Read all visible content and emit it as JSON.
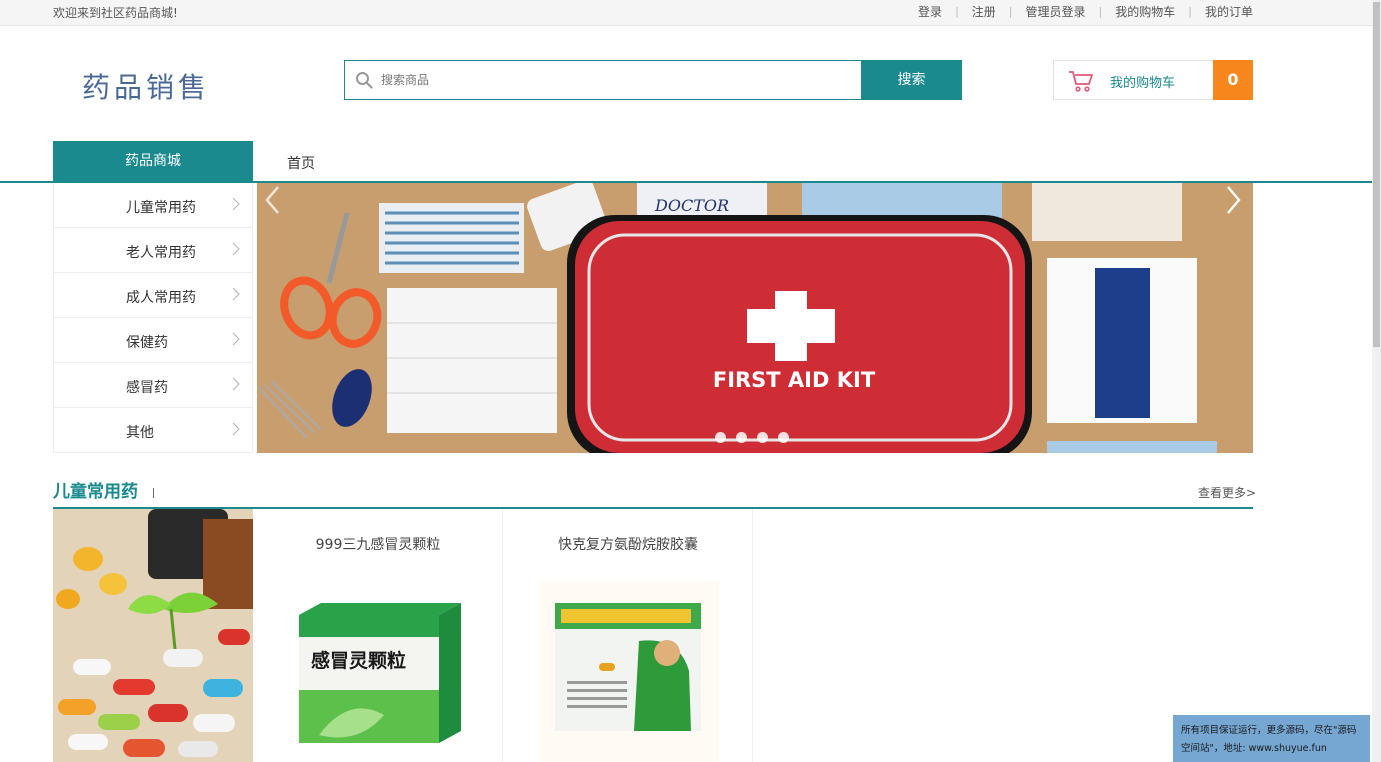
{
  "topbar": {
    "welcome": "欢迎来到社区药品商城!",
    "links": [
      {
        "label": "登录"
      },
      {
        "label": "注册"
      },
      {
        "label": "管理员登录"
      },
      {
        "label": "我的购物车"
      },
      {
        "label": "我的订单"
      }
    ]
  },
  "header": {
    "logo": "药品销售",
    "search": {
      "placeholder": "搜索商品",
      "button_label": "搜索"
    },
    "cart": {
      "label": "我的购物车",
      "count": "0"
    }
  },
  "nav": {
    "category_title": "药品商城",
    "home_label": "首页"
  },
  "categories": [
    {
      "label": "儿童常用药"
    },
    {
      "label": "老人常用药"
    },
    {
      "label": "成人常用药"
    },
    {
      "label": "保健药"
    },
    {
      "label": "感冒药"
    },
    {
      "label": "其他"
    }
  ],
  "banner": {
    "kit_text": "FIRST AID KIT",
    "carousel_dots": 4,
    "active_dot": 1
  },
  "section": {
    "title": "儿童常用药",
    "more": "查看更多>"
  },
  "products": [
    {
      "name": "999三九感冒灵颗粒",
      "box_text": "感冒灵颗粒"
    },
    {
      "name": "快克复方氨酚烷胺胶囊"
    }
  ],
  "notice": "所有项目保证运行，更多源码，尽在\"源码空间站\"，地址: www.shuyue.fun",
  "colors": {
    "accent": "#1b8a8f",
    "cart_count_bg": "#f7861c",
    "logo": "#4a6a96"
  },
  "icons": [
    "search-icon",
    "cart-icon",
    "chevron-right-icon",
    "arrow-left-icon",
    "arrow-right-icon"
  ]
}
